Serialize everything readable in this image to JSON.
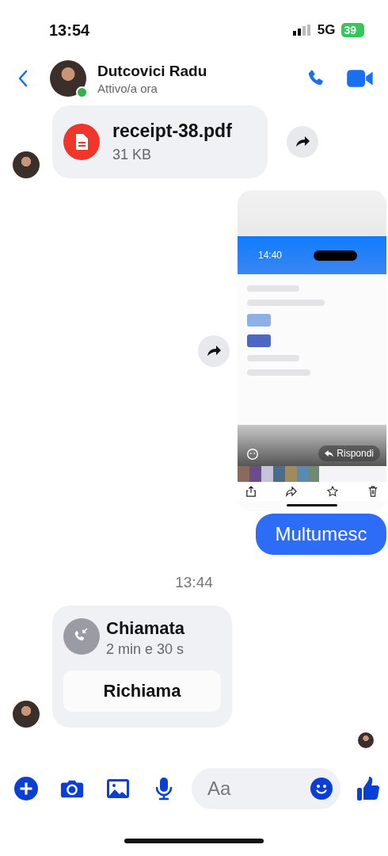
{
  "status_bar": {
    "time": "13:54",
    "network": "5G",
    "battery": "39"
  },
  "header": {
    "name": "Dutcovici Radu",
    "status": "Attivo/a ora",
    "online": true
  },
  "messages": [
    {
      "kind": "file",
      "outgoing": false,
      "name": "receipt-38.pdf",
      "size": "31 KB"
    },
    {
      "kind": "screenshot",
      "outgoing": true,
      "time": "14:40",
      "reply": "Rispondi"
    },
    {
      "kind": "text",
      "outgoing": true,
      "text": "Multumesc"
    },
    {
      "kind": "timestamp",
      "text": "13:44"
    },
    {
      "kind": "call",
      "outgoing": false,
      "title": "Chiamata",
      "duration": "2 min e 30 s",
      "action": "Richiama"
    }
  ],
  "composer": {
    "placeholder": "Aa"
  }
}
